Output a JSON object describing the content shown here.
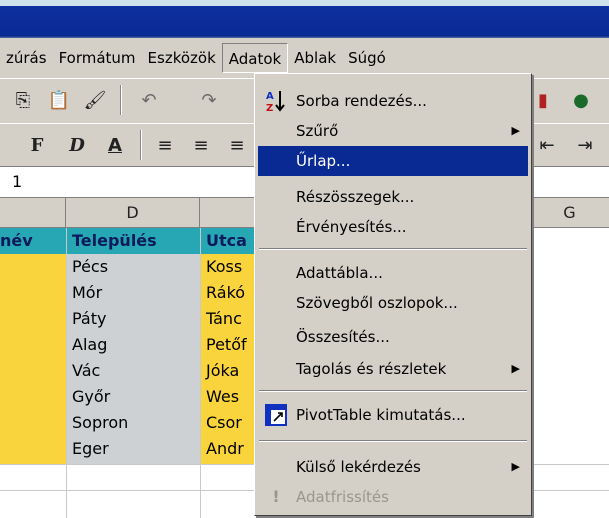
{
  "menubar": {
    "items": [
      "zúrás",
      "Formátum",
      "Eszközök",
      "Adatok",
      "Ablak",
      "Súgó"
    ]
  },
  "toolbar2": {
    "bold": "F",
    "italic": "D",
    "underline": "A"
  },
  "formula_bar": {
    "value": "1"
  },
  "grid": {
    "col_headers": [
      "D",
      "G"
    ],
    "header_row": [
      "név",
      "Település",
      "Utca"
    ],
    "rows": [
      [
        "Pécs",
        "Koss"
      ],
      [
        "Mór",
        "Rákó"
      ],
      [
        "Páty",
        "Tánc"
      ],
      [
        "Alag",
        "Petőf"
      ],
      [
        "Vác",
        "Jóka"
      ],
      [
        "Győr",
        "Wes"
      ],
      [
        "Sopron",
        "Csor"
      ],
      [
        "Eger",
        "Andr"
      ]
    ]
  },
  "dropdown": {
    "items": [
      {
        "label": "Sorba rendezés...",
        "icon": "sort-az-icon"
      },
      {
        "label": "Szűrő",
        "submenu": true
      },
      {
        "label": "Űrlap...",
        "highlighted": true
      },
      {
        "label": "Részösszegek..."
      },
      {
        "label": "Érvényesítés..."
      },
      {
        "label": "Adattábla..."
      },
      {
        "label": "Szövegből oszlopok..."
      },
      {
        "label": "Összesítés..."
      },
      {
        "label": "Tagolás és részletek",
        "submenu": true
      },
      {
        "label": "PivotTable kimutatás...",
        "icon": "pivot-table-icon"
      },
      {
        "label": "Külső lekérdezés",
        "submenu": true
      },
      {
        "label": "Adatfrissítés",
        "disabled": true,
        "icon": "refresh-icon"
      }
    ]
  },
  "colors": {
    "title_bar": "#0a2a93",
    "highlight": "#0a2a93",
    "header_fill": "#27a7b4",
    "yellow_fill": "#f9d43c"
  }
}
